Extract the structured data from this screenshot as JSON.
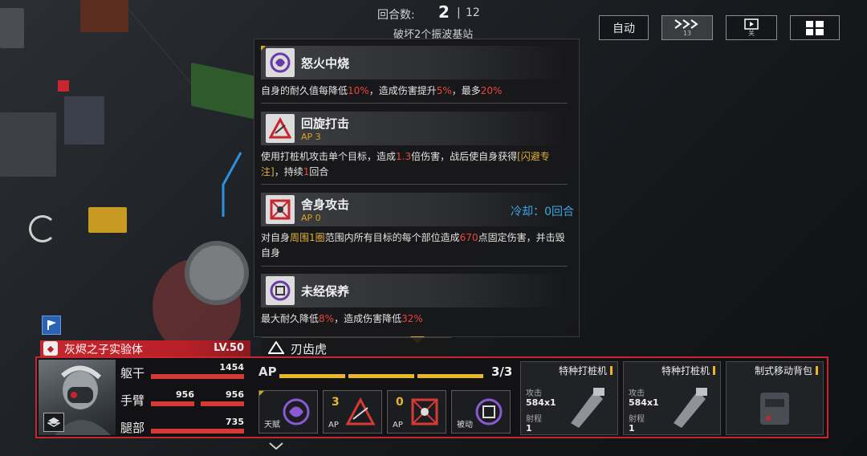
{
  "hud": {
    "round_label": "回合数:",
    "round_current": "2",
    "round_separator": "|",
    "round_max": "12",
    "objective": "破坏2个振波基站",
    "buttons": {
      "auto": "自动",
      "speed_sub": "13",
      "video_sub": "关"
    }
  },
  "tooltip": {
    "skills": [
      {
        "name": "怒火中烧",
        "desc": [
          {
            "t": "自身的耐久值每降低"
          },
          {
            "t": "10%",
            "c": "red"
          },
          {
            "t": "，造成伤害提升"
          },
          {
            "t": "5%",
            "c": "red"
          },
          {
            "t": "，最多"
          },
          {
            "t": "20%",
            "c": "red"
          }
        ]
      },
      {
        "name": "回旋打击",
        "ap": "AP 3",
        "desc": [
          {
            "t": "使用打桩机攻击单个目标，造成"
          },
          {
            "t": "1.3",
            "c": "red"
          },
          {
            "t": "倍伤害，战后使自身获得"
          },
          {
            "t": "[闪避专注]",
            "c": "gold"
          },
          {
            "t": "，持续"
          },
          {
            "t": "1",
            "c": "red"
          },
          {
            "t": "回合"
          }
        ]
      },
      {
        "name": "舍身攻击",
        "ap": "AP 0",
        "cooldown": "冷却：0回合",
        "desc": [
          {
            "t": "对自身"
          },
          {
            "t": "周围1圈",
            "c": "gold"
          },
          {
            "t": "范围内所有目标的每个部位造成"
          },
          {
            "t": "670",
            "c": "red"
          },
          {
            "t": "点固定伤害，并击毁自身"
          }
        ]
      },
      {
        "name": "未经保养",
        "desc": [
          {
            "t": "最大耐久降低"
          },
          {
            "t": "8%",
            "c": "red"
          },
          {
            "t": "，造成伤害降低"
          },
          {
            "t": "32%",
            "c": "red"
          }
        ]
      }
    ]
  },
  "unit": {
    "name": "灰烬之子实验体",
    "level": "LV.50",
    "enemy_name": "刃齿虎",
    "parts": [
      {
        "label": "躯干",
        "values": [
          "1454"
        ],
        "fill": [
          1.0
        ]
      },
      {
        "label": "手臂",
        "values": [
          "956",
          "956"
        ],
        "fill": [
          1.0,
          1.0
        ]
      },
      {
        "label": "腿部",
        "values": [
          "735"
        ],
        "fill": [
          1.0
        ]
      }
    ],
    "ap": {
      "label": "AP",
      "current": "3/3",
      "filled": 3,
      "total": 3
    },
    "skill_slots": [
      {
        "tag": "天赋",
        "num": "",
        "icon": "swirl-talent-icon"
      },
      {
        "tag": "AP",
        "num": "3",
        "icon": "spin-strike-icon"
      },
      {
        "tag": "AP",
        "num": "0",
        "icon": "self-destruct-icon"
      },
      {
        "tag": "被动",
        "num": "",
        "icon": "maintenance-icon"
      }
    ],
    "weapons": [
      {
        "title": "特种打桩机",
        "stat1": "攻击",
        "val1": "584x1",
        "stat2": "射程",
        "val2": "1",
        "icon": "pile-driver-icon"
      },
      {
        "title": "特种打桩机",
        "stat1": "攻击",
        "val1": "584x1",
        "stat2": "射程",
        "val2": "1",
        "icon": "pile-driver-icon"
      },
      {
        "title": "制式移动背包",
        "icon": "backpack-icon"
      }
    ]
  },
  "colors": {
    "accent_red": "#c8262e",
    "ap_gold": "#e8b62a",
    "cooldown_blue": "#39a6e8",
    "damage_red": "#e8453c"
  }
}
